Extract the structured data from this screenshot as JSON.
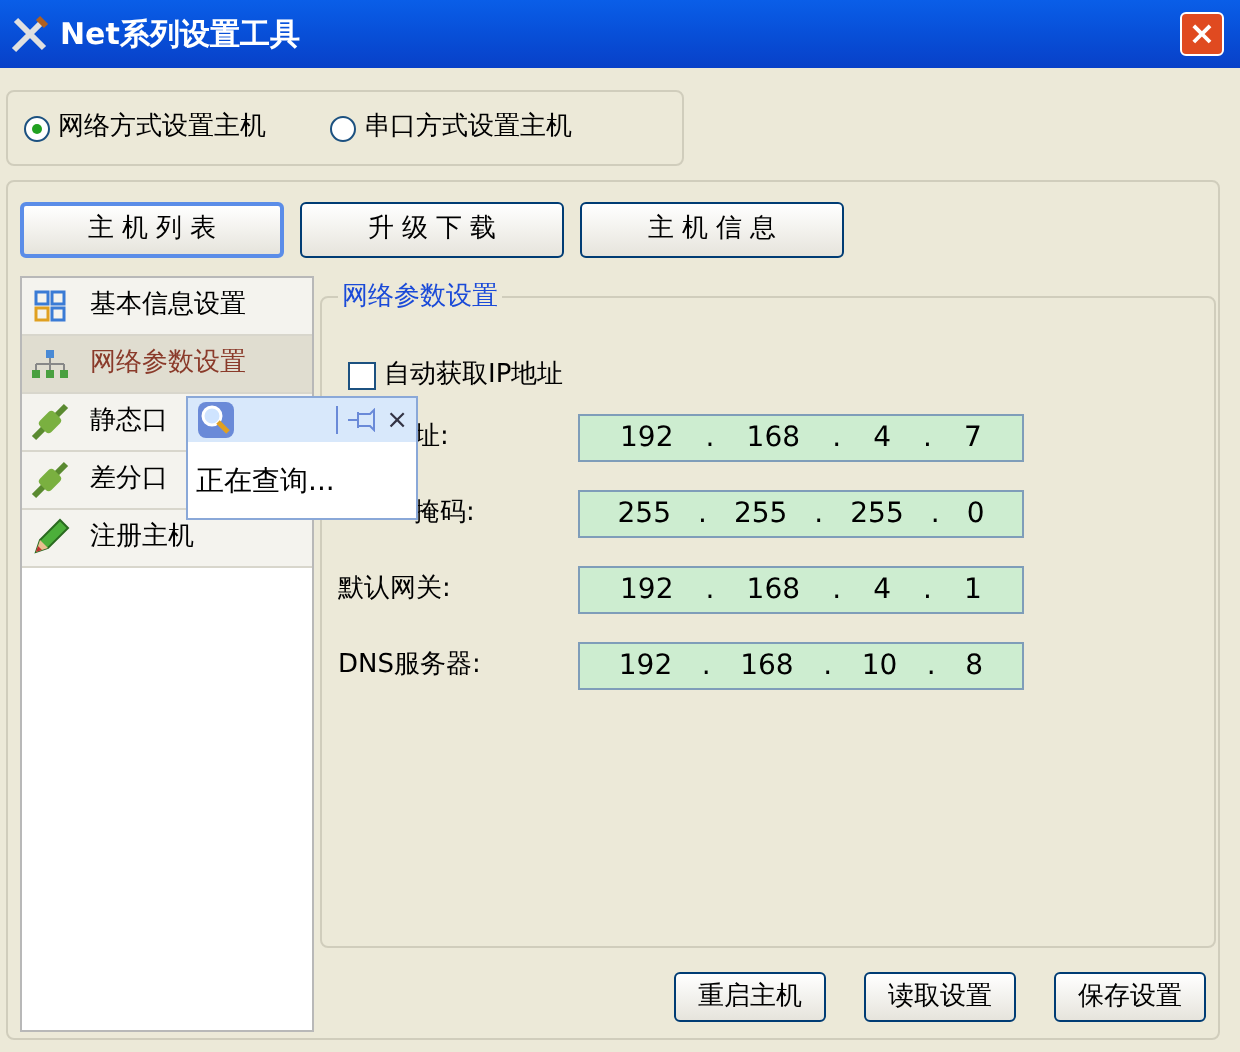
{
  "window": {
    "title": "Net系列设置工具",
    "close": "×"
  },
  "mode_options": [
    {
      "label": "网络方式设置主机",
      "selected": true
    },
    {
      "label": "串口方式设置主机",
      "selected": false
    }
  ],
  "tabs": [
    {
      "label": "主 机 列 表",
      "selected": true
    },
    {
      "label": "升 级 下 载",
      "selected": false
    },
    {
      "label": "主 机 信 息",
      "selected": false
    }
  ],
  "sidebar": {
    "items": [
      {
        "label": "基本信息设置",
        "kind": "grid",
        "selected": false
      },
      {
        "label": "网络参数设置",
        "kind": "network",
        "selected": true
      },
      {
        "label": "静态口",
        "kind": "plug",
        "selected": false
      },
      {
        "label": "差分口",
        "kind": "plug",
        "selected": false
      },
      {
        "label": "注册主机",
        "kind": "pencil",
        "selected": false
      }
    ]
  },
  "group": {
    "title": "网络参数设置",
    "auto_ip": {
      "label": "自动获取IP地址",
      "checked": false
    },
    "fields": [
      {
        "label": "址:",
        "segments": [
          "192",
          ".",
          "168",
          ".",
          "4",
          ".",
          "7"
        ]
      },
      {
        "label": "掩码:",
        "segments": [
          "255",
          ".",
          "255",
          ".",
          "255",
          ".",
          "0"
        ]
      },
      {
        "label": "默认网关:",
        "segments": [
          "192",
          ".",
          "168",
          ".",
          "4",
          ".",
          "1"
        ]
      },
      {
        "label": "DNS服务器:",
        "segments": [
          "192",
          ".",
          "168",
          ".",
          "10",
          ".",
          "8"
        ]
      }
    ]
  },
  "popup": {
    "message": "正在查询...",
    "close": "×"
  },
  "buttons": [
    "重启主机",
    "读取设置",
    "保存设置"
  ]
}
